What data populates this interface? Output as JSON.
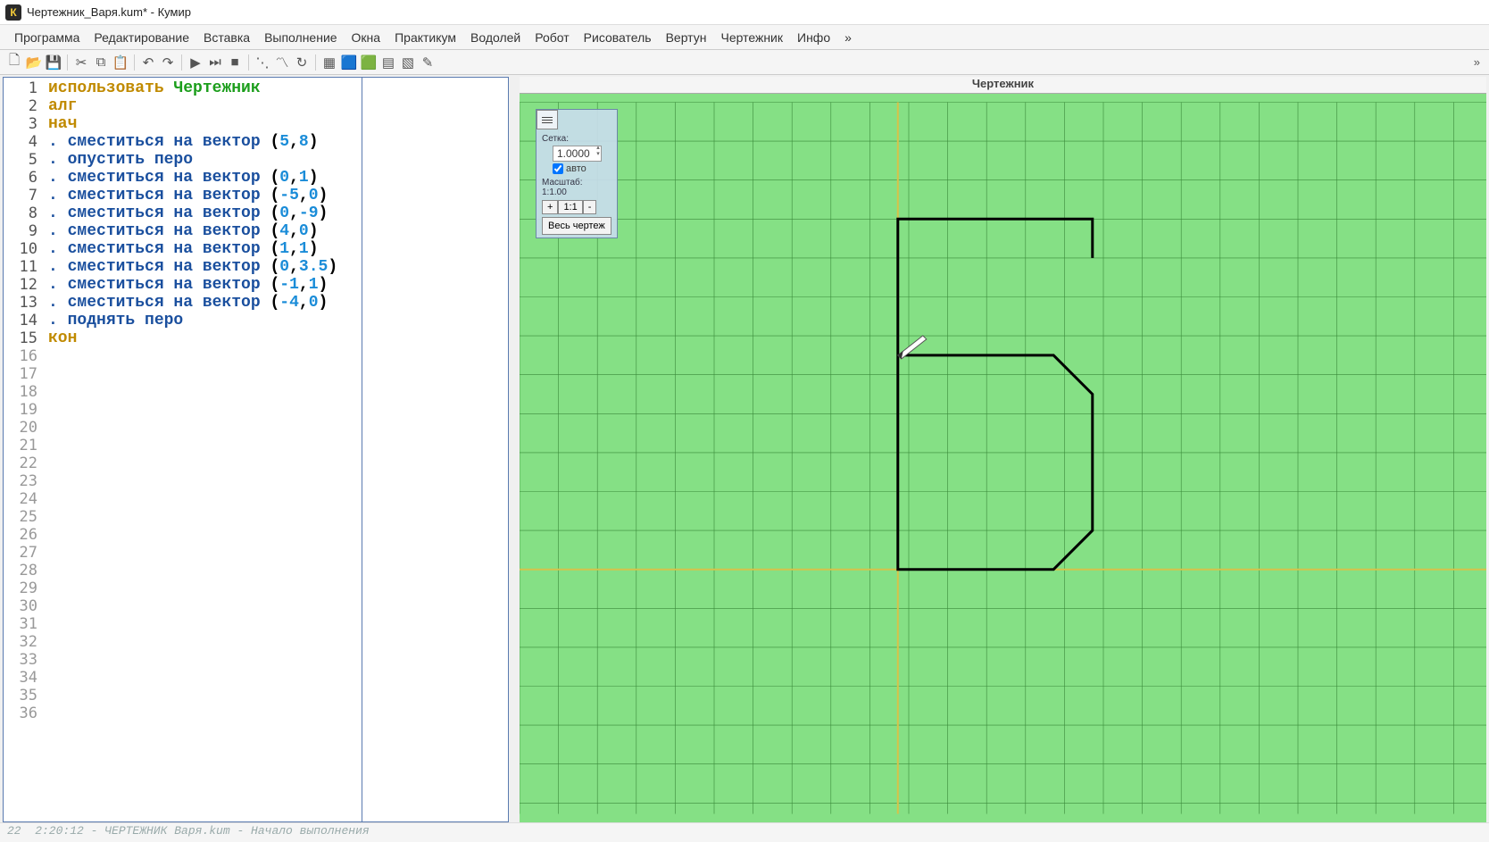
{
  "title": "Чертежник_Варя.kum* - Кумир",
  "appIconLetter": "К",
  "menu": [
    "Программа",
    "Редактирование",
    "Вставка",
    "Выполнение",
    "Окна",
    "Практикум",
    "Водолей",
    "Робот",
    "Рисователь",
    "Вертун",
    "Чертежник",
    "Инфо",
    "»"
  ],
  "toolbarOverflow": "»",
  "viz": {
    "title": "Чертежник",
    "controls": {
      "gridLabel": "Сетка:",
      "gridValue": "1.0000",
      "autoLabel": "авто",
      "scaleLabel": "Масштаб:",
      "scaleValue": "1:1.00",
      "zoomIn": "+",
      "zoomReset": "1:1",
      "zoomOut": "-",
      "fit": "Весь чертеж"
    }
  },
  "editor": {
    "visibleLines": 36,
    "activeLines": 15,
    "code": [
      {
        "t": "use",
        "use": "использовать",
        "mod": "Чертежник"
      },
      {
        "t": "kw",
        "text": "алг"
      },
      {
        "t": "kw",
        "text": "нач"
      },
      {
        "t": "mv",
        "cmd": "сместиться на вектор",
        "a": "5",
        "b": "8"
      },
      {
        "t": "cmd",
        "cmd": "опустить перо"
      },
      {
        "t": "mv",
        "cmd": "сместиться на вектор",
        "a": "0",
        "b": "1"
      },
      {
        "t": "mv",
        "cmd": "сместиться на вектор",
        "a": "-5",
        "b": "0"
      },
      {
        "t": "mv",
        "cmd": "сместиться на вектор",
        "a": "0",
        "b": "-9"
      },
      {
        "t": "mv",
        "cmd": "сместиться на вектор",
        "a": "4",
        "b": "0"
      },
      {
        "t": "mv",
        "cmd": "сместиться на вектор",
        "a": "1",
        "b": "1"
      },
      {
        "t": "mv",
        "cmd": "сместиться на вектор",
        "a": "0",
        "b": "3.5"
      },
      {
        "t": "mv",
        "cmd": "сместиться на вектор",
        "a": "-1",
        "b": "1"
      },
      {
        "t": "mv",
        "cmd": "сместиться на вектор",
        "a": "-4",
        "b": "0"
      },
      {
        "t": "cmd",
        "cmd": "поднять перо"
      },
      {
        "t": "kw",
        "text": "кон"
      }
    ]
  },
  "drawing": {
    "cell": 43.6,
    "originCol": 9.72,
    "originRow": 12,
    "start": [
      5,
      8
    ],
    "moves": [
      [
        0,
        1
      ],
      [
        -5,
        0
      ],
      [
        0,
        -9
      ],
      [
        4,
        0
      ],
      [
        1,
        1
      ],
      [
        0,
        3.5
      ],
      [
        -1,
        1
      ],
      [
        -4,
        0
      ]
    ]
  },
  "status": "22  2:20:12 - ЧЕРТЕЖНИК Варя.kum - Начало выполнения"
}
